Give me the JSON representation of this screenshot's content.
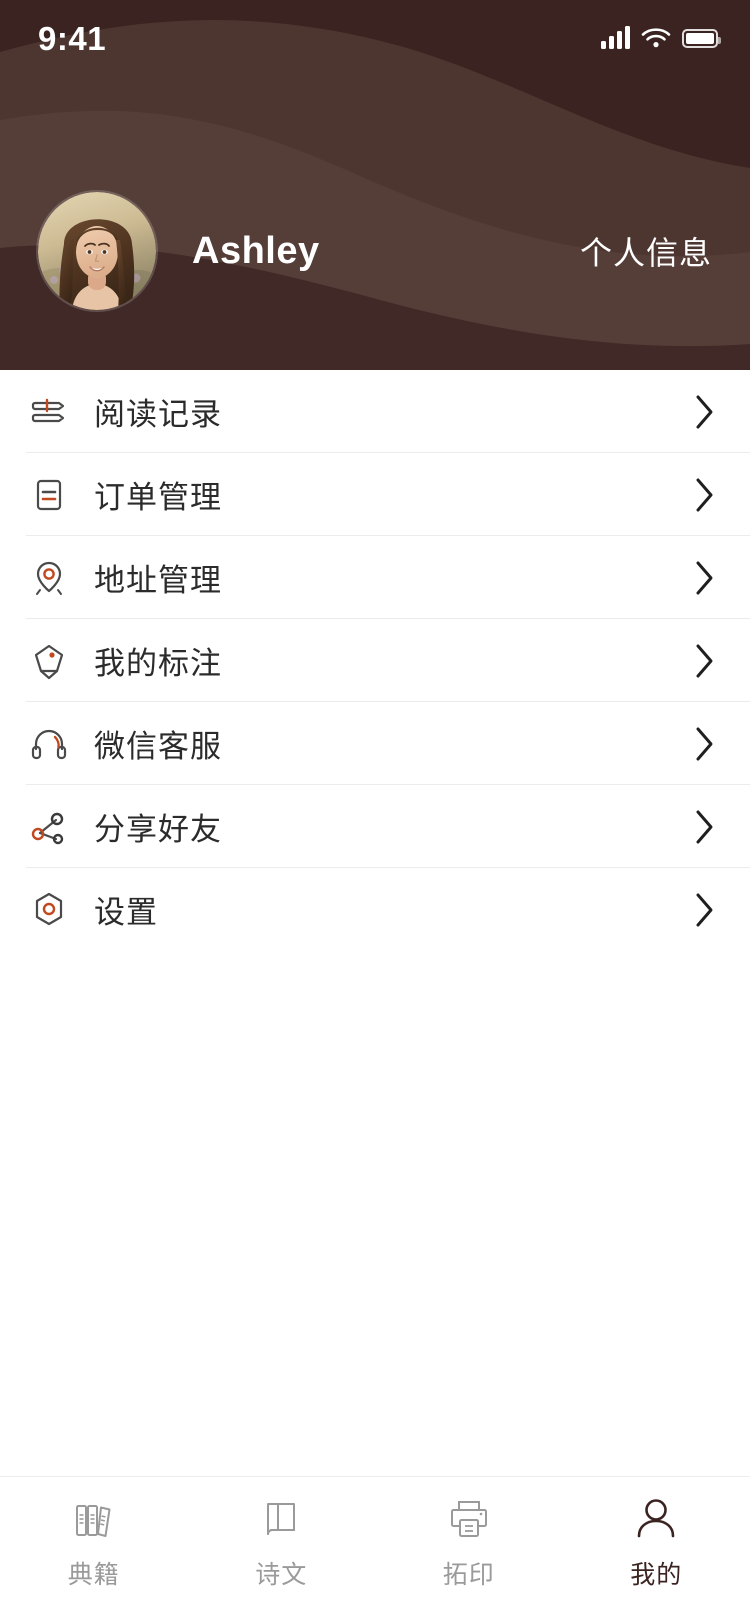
{
  "statusbar": {
    "time": "9:41",
    "signal_icon": "cellular-signal-icon",
    "wifi_icon": "wifi-icon",
    "battery_icon": "battery-icon"
  },
  "header": {
    "avatar_name": "user-avatar-photo",
    "username": "Ashley",
    "personal_info_label": "个人信息",
    "bg_color": "#4d3530",
    "bg_color_dark": "#3a2320",
    "bg_color_light": "#5d4440",
    "text_color": "#ffffff"
  },
  "menu": {
    "items": [
      {
        "label": "阅读记录",
        "icon": "books-stack-icon",
        "chevron": "chevron-right-icon"
      },
      {
        "label": "订单管理",
        "icon": "order-list-icon",
        "chevron": "chevron-right-icon"
      },
      {
        "label": "地址管理",
        "icon": "location-pin-icon",
        "chevron": "chevron-right-icon"
      },
      {
        "label": "我的标注",
        "icon": "bookmark-tag-icon",
        "chevron": "chevron-right-icon"
      },
      {
        "label": "微信客服",
        "icon": "headset-icon",
        "chevron": "chevron-right-icon"
      },
      {
        "label": "分享好友",
        "icon": "share-nodes-icon",
        "chevron": "chevron-right-icon"
      },
      {
        "label": "设置",
        "icon": "settings-gear-icon",
        "chevron": "chevron-right-icon"
      }
    ],
    "accent_color": "#c1491f",
    "icon_color": "#4a4a4a",
    "label_color": "#2b2b2b"
  },
  "tabbar": {
    "tabs": [
      {
        "label": "典籍",
        "icon": "bookshelf-icon",
        "active": false
      },
      {
        "label": "诗文",
        "icon": "open-book-icon",
        "active": false
      },
      {
        "label": "拓印",
        "icon": "printer-icon",
        "active": false
      },
      {
        "label": "我的",
        "icon": "person-icon",
        "active": true
      }
    ],
    "active_color": "#3a2320",
    "inactive_color": "#9a9a9a"
  }
}
